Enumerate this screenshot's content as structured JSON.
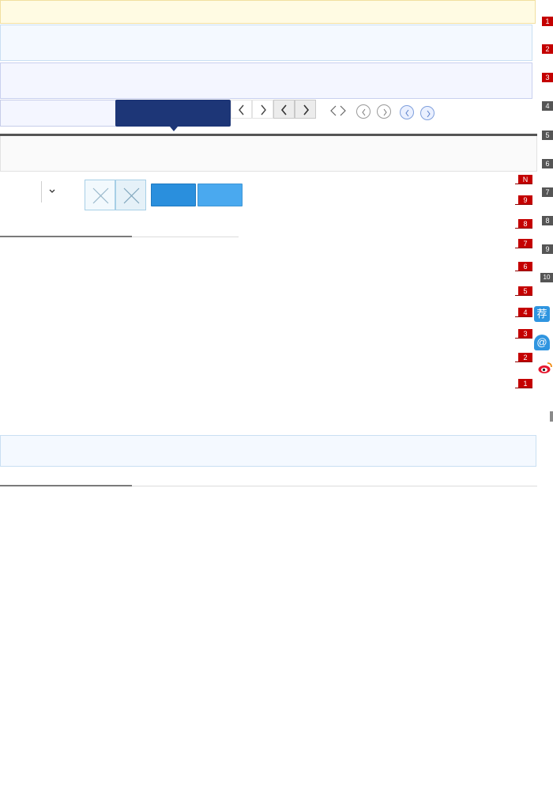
{
  "ranking_list": [
    "N",
    "9",
    "8",
    "7",
    "6",
    "5",
    "4",
    "3",
    "2",
    "1"
  ],
  "side_ranks": {
    "red": [
      "1",
      "2",
      "3"
    ],
    "gray": [
      "4",
      "5",
      "6",
      "7",
      "8",
      "9",
      "10"
    ]
  },
  "share": {
    "recommend_icon": "荐",
    "at_icon": "@"
  },
  "colors": {
    "accent_navy": "#1d3677",
    "button_blue": "#2a8fdd",
    "button_light_blue": "#4aa9ef",
    "badge_red": "#c40000",
    "badge_gray": "#555555"
  }
}
